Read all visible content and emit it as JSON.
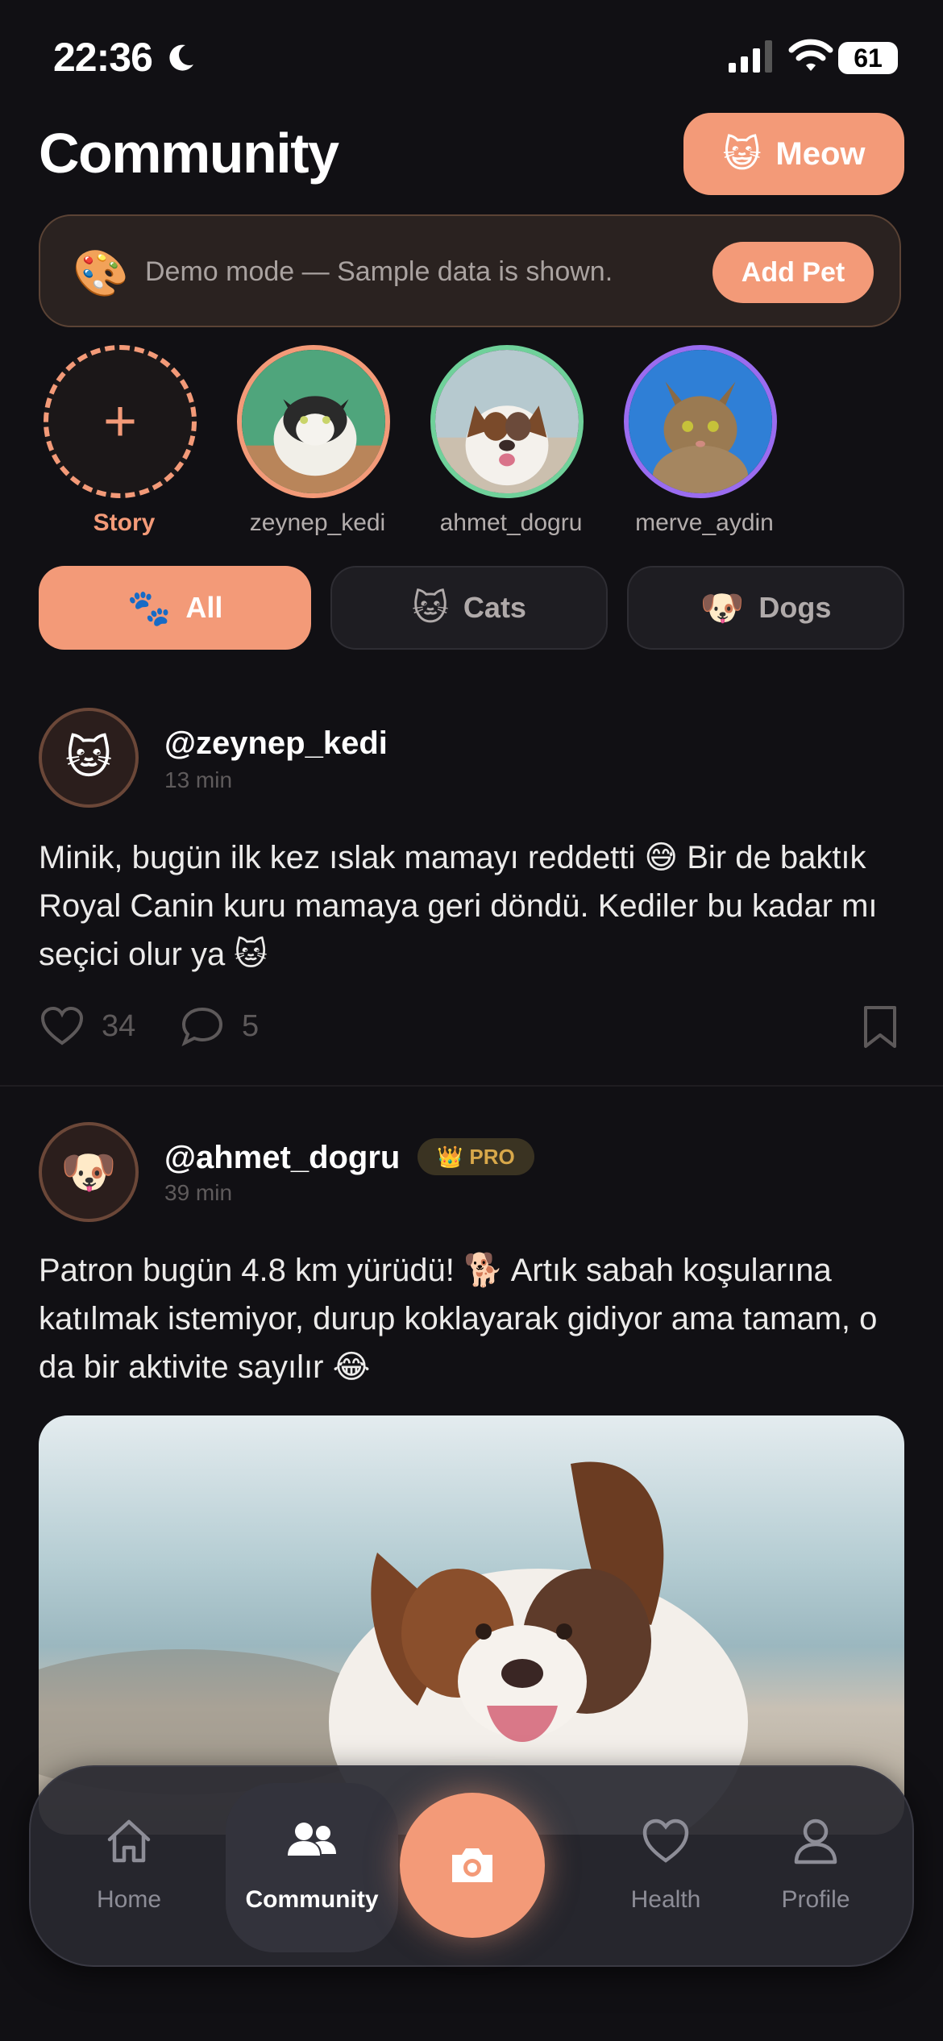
{
  "status": {
    "time": "22:36",
    "battery": "61"
  },
  "header": {
    "title": "Community",
    "meow_button": {
      "emoji": "😺",
      "label": "Meow"
    }
  },
  "banner": {
    "emoji": "🎨",
    "text": "Demo mode — Sample data is shown.",
    "button": "Add Pet"
  },
  "stories": [
    {
      "label": "Story",
      "type": "add"
    },
    {
      "label": "zeynep_kedi",
      "ring": "#f39a78"
    },
    {
      "label": "ahmet_dogru",
      "ring": "#6fd19a"
    },
    {
      "label": "merve_aydin",
      "ring": "#9a6cf0"
    }
  ],
  "filters": [
    {
      "emoji": "🐾",
      "label": "All",
      "active": true
    },
    {
      "emoji": "🐱",
      "label": "Cats",
      "active": false
    },
    {
      "emoji": "🐶",
      "label": "Dogs",
      "active": false
    }
  ],
  "posts": [
    {
      "avatar": "🐱",
      "username": "@zeynep_kedi",
      "time": "13 min",
      "text": "Minik, bugün ilk kez ıslak mamayı reddetti 😅 Bir de baktık Royal Canin kuru mamaya geri döndü. Kediler bu kadar mı seçici olur ya 🐱",
      "likes": "34",
      "comments": "5"
    },
    {
      "avatar": "🐶",
      "username": "@ahmet_dogru",
      "badge": {
        "emoji": "👑",
        "label": "PRO"
      },
      "time": "39 min",
      "text": "Patron bugün 4.8 km yürüdü! 🐕 Artık sabah koşularına katılmak istemiyor, durup koklayarak gidiyor ama tamam, o da bir aktivite sayılır 😂"
    }
  ],
  "tabbar": {
    "tabs": [
      {
        "label": "Home",
        "icon": "home-icon"
      },
      {
        "label": "Community",
        "icon": "people-icon",
        "active": true
      },
      {
        "label": "Health",
        "icon": "heart-icon"
      },
      {
        "label": "Profile",
        "icon": "person-icon"
      }
    ],
    "camera_icon": "camera-icon"
  },
  "colors": {
    "accent": "#f39a78",
    "background": "#111014"
  }
}
